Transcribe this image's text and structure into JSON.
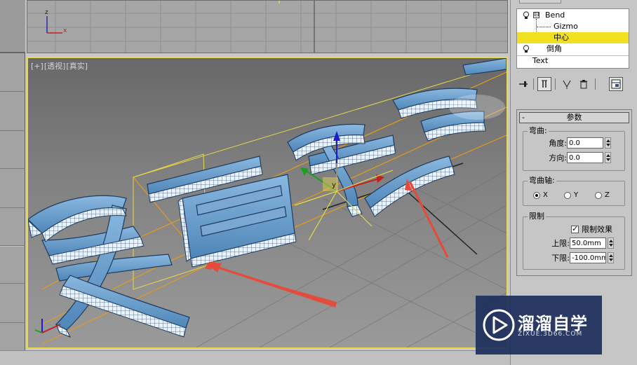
{
  "viewports": {
    "top_axis": {
      "z": "z",
      "x": "x"
    },
    "perspective_label": [
      "[+]",
      "[透视]",
      "[真实]"
    ],
    "gizmo_axis_y": "y",
    "accent_border": "#e8d84a"
  },
  "modifier_stack": {
    "items": [
      {
        "label": "Bend",
        "has_bulb": true,
        "expander": "⊟"
      },
      {
        "label": "Gizmo",
        "has_bulb": false
      },
      {
        "label": "中心",
        "has_bulb": false,
        "selected": true
      },
      {
        "label": "倒角",
        "has_bulb": true
      },
      {
        "label": "Text",
        "has_bulb": false
      }
    ],
    "selected_color": "#f0e020"
  },
  "stack_toolbar": {
    "icons": [
      "pin-stack-icon",
      "show-end-result-icon",
      "make-unique-icon",
      "remove-modifier-icon",
      "configure-modifier-sets-icon"
    ]
  },
  "params": {
    "rollout_collapse": "-",
    "rollout_title": "参数",
    "bend_group": {
      "title": "弯曲:",
      "angle_label": "角度:",
      "angle_value": "0.0",
      "direction_label": "方向:",
      "direction_value": "0.0"
    },
    "bend_axis_group": {
      "title": "弯曲轴:",
      "options": [
        "X",
        "Y",
        "Z"
      ],
      "selected": "X"
    },
    "limits_group": {
      "title": "限制",
      "limit_effect_label": "限制效果",
      "limit_effect_checked": true,
      "upper_label": "上限:",
      "upper_value": "50.0mm",
      "lower_label": "下限:",
      "lower_value": "-100.0mm"
    }
  },
  "watermark": {
    "title": "溜溜自学",
    "subtitle": "ZIXUE.3D66.COM"
  }
}
